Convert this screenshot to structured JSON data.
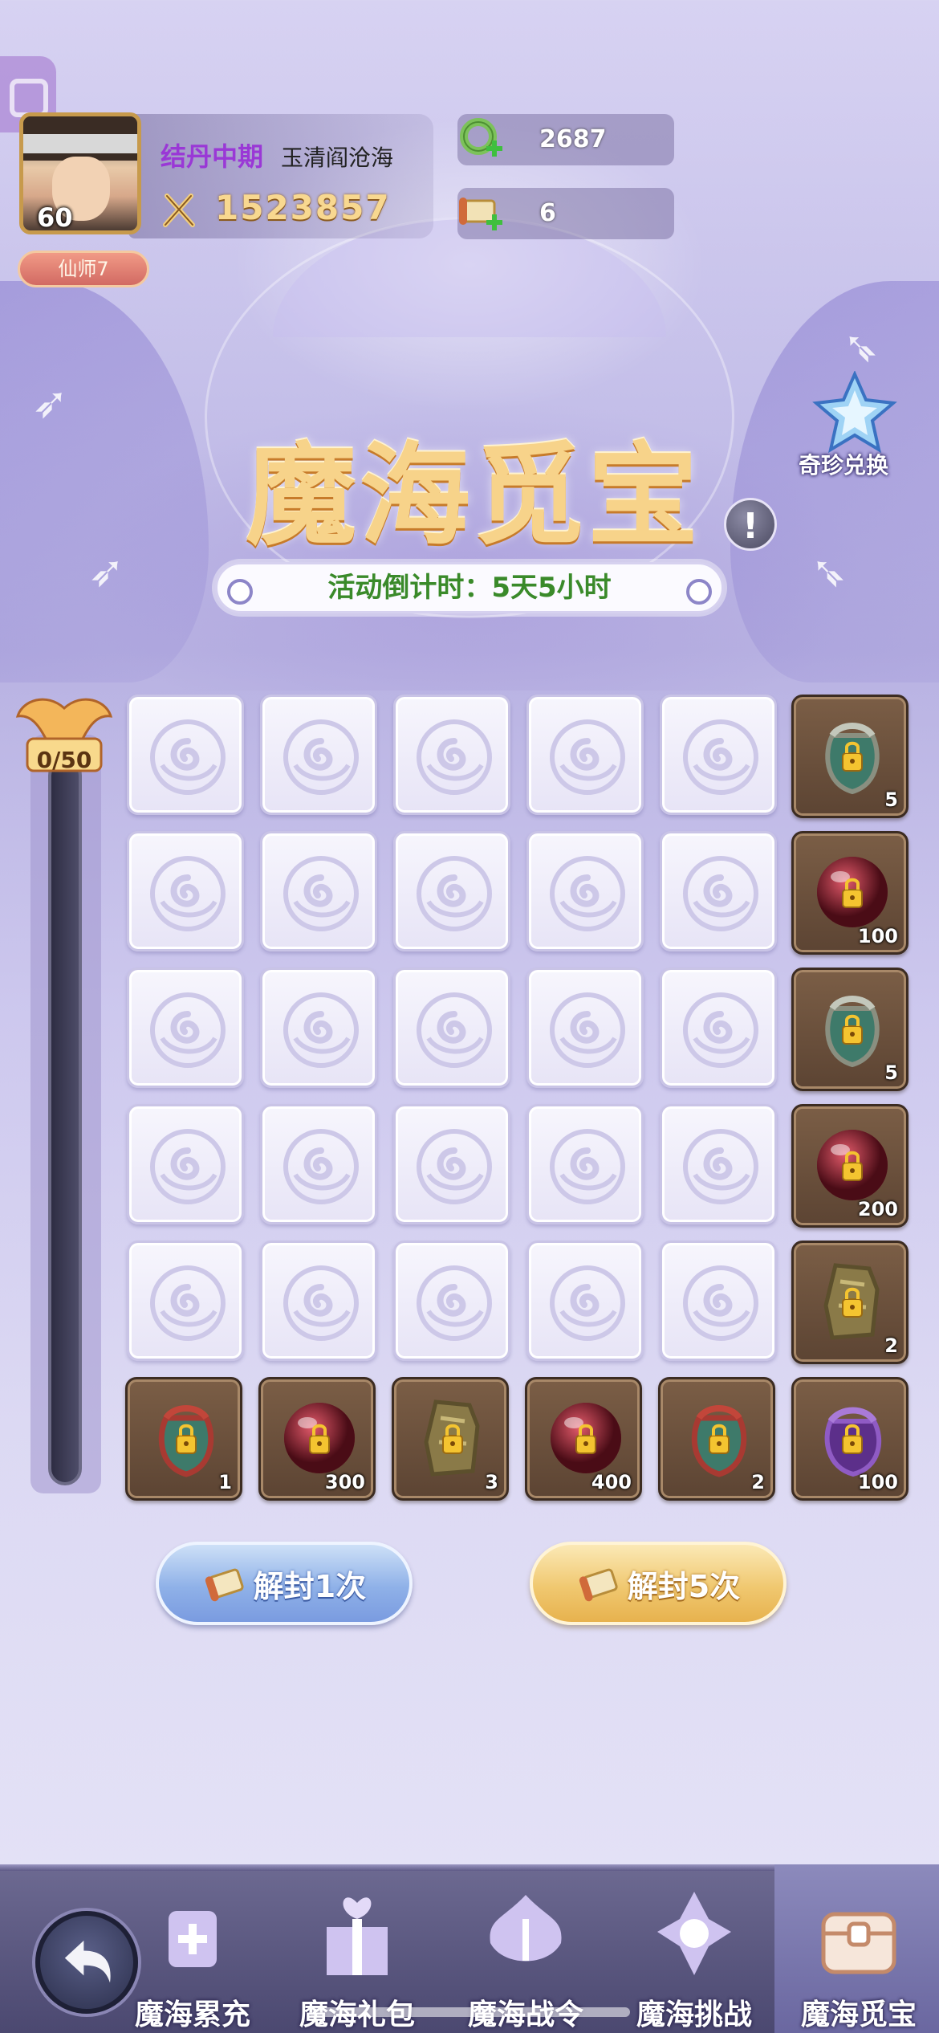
{
  "player": {
    "level": "60",
    "realm": "结丹中期",
    "sect": "玉清阎沧海",
    "power": "1523857",
    "title_badge": "仙师7"
  },
  "resources": [
    {
      "icon": "jade-ring-icon",
      "value": "2687"
    },
    {
      "icon": "scroll-ticket-icon",
      "value": "6"
    }
  ],
  "exchange": {
    "label": "奇珍兑换",
    "icon": "crystal-star-icon"
  },
  "event": {
    "title": "魔海觅宝",
    "countdown": "活动倒计时：5天5小时"
  },
  "progress": {
    "text": "0/50",
    "value": 0,
    "max": 50
  },
  "grid": {
    "rows": 5,
    "cols": 5,
    "tile_icon": "cloud-swirl-icon"
  },
  "rewards_right": [
    {
      "item": "green-pouch",
      "qty": "5"
    },
    {
      "item": "red-orb",
      "qty": "100"
    },
    {
      "item": "green-pouch",
      "qty": "5"
    },
    {
      "item": "red-orb",
      "qty": "200"
    },
    {
      "item": "gold-token",
      "qty": "2"
    }
  ],
  "rewards_bottom": [
    {
      "item": "red-pouch",
      "qty": "1"
    },
    {
      "item": "red-orb",
      "qty": "300"
    },
    {
      "item": "gold-token",
      "qty": "3"
    },
    {
      "item": "red-orb",
      "qty": "400"
    },
    {
      "item": "red-pouch",
      "qty": "2"
    },
    {
      "item": "purple-pouch",
      "qty": "100"
    }
  ],
  "buttons": {
    "unseal_1": "解封1次",
    "unseal_5": "解封5次"
  },
  "nav": {
    "items": [
      {
        "label": "魔海累充",
        "icon": "recharge-icon"
      },
      {
        "label": "魔海礼包",
        "icon": "gift-pack-icon"
      },
      {
        "label": "魔海战令",
        "icon": "battle-pass-icon"
      },
      {
        "label": "魔海挑战",
        "icon": "challenge-icon"
      },
      {
        "label": "魔海觅宝",
        "icon": "treasure-chest-icon"
      }
    ],
    "active_index": 4
  },
  "colors": {
    "countdown_green": "#3a8a2a",
    "realm_purple": "#9a38d6",
    "title_gold": "#f7d38a"
  }
}
